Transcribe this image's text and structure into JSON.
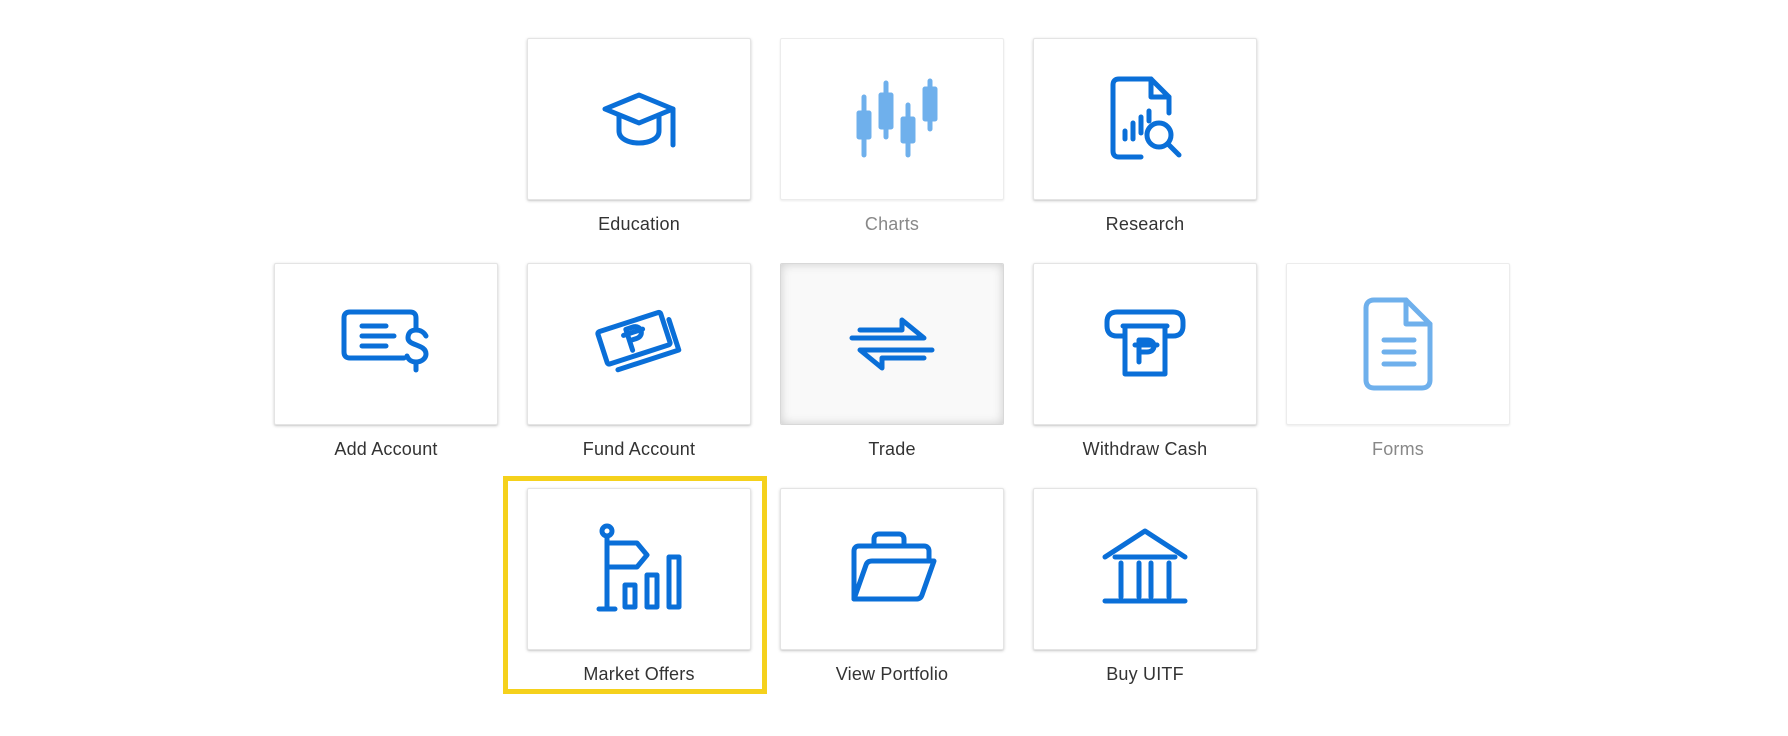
{
  "colors": {
    "icon_blue": "#0a6fd8",
    "icon_light_blue": "#6fb0ec",
    "highlight_yellow": "#f5d11c",
    "label_text": "#333333",
    "label_disabled": "#888888"
  },
  "tiles": [
    {
      "label": "Education",
      "icon": "graduation-cap-icon",
      "disabled": false
    },
    {
      "label": "Charts",
      "icon": "candlestick-chart-icon",
      "disabled": true
    },
    {
      "label": "Research",
      "icon": "document-search-icon",
      "disabled": false
    },
    {
      "label": "Add Account",
      "icon": "card-dollar-icon",
      "disabled": false
    },
    {
      "label": "Fund Account",
      "icon": "peso-bills-icon",
      "disabled": false
    },
    {
      "label": "Trade",
      "icon": "exchange-arrows-icon",
      "disabled": false,
      "pressed": true
    },
    {
      "label": "Withdraw Cash",
      "icon": "atm-peso-icon",
      "disabled": false
    },
    {
      "label": "Forms",
      "icon": "document-icon",
      "disabled": true
    },
    {
      "label": "Market Offers",
      "icon": "flag-bar-chart-icon",
      "disabled": false,
      "highlighted": true
    },
    {
      "label": "View Portfolio",
      "icon": "open-folder-icon",
      "disabled": false
    },
    {
      "label": "Buy UITF",
      "icon": "bank-building-icon",
      "disabled": false
    }
  ]
}
